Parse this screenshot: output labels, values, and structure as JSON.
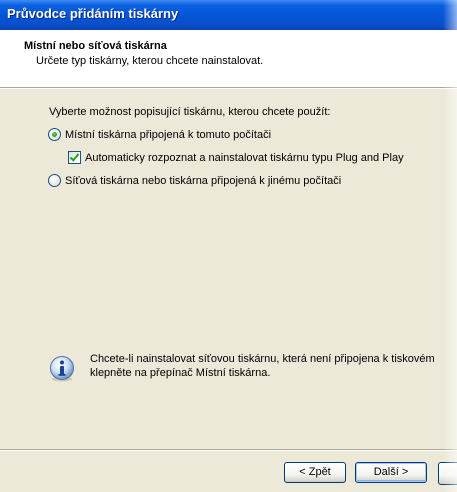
{
  "window": {
    "title": "Průvodce přidáním tiskárny"
  },
  "header": {
    "title": "Místní nebo síťová tiskárna",
    "subtitle": "Určete typ tiskárny, kterou chcete nainstalovat."
  },
  "content": {
    "prompt": "Vyberte možnost popisující tiskárnu, kterou chcete použít:",
    "options": [
      {
        "label": "Místní tiskárna připojená k tomuto počítači",
        "checked": true
      },
      {
        "label": "Síťová tiskárna nebo tiskárna připojená k jinému počítači",
        "checked": false
      }
    ],
    "plug_and_play": {
      "label": "Automaticky rozpoznat a nainstalovat tiskárnu typu Plug and Play",
      "checked": true
    },
    "info": {
      "line1": "Chcete-li nainstalovat síťovou tiskárnu, která není připojena k tiskovém",
      "line2": "klepněte na přepínač Místní tiskárna."
    }
  },
  "buttons": {
    "back": "< Zpět",
    "next": "Další >"
  },
  "colors": {
    "titlebar": "#0454d6",
    "dialog_bg": "#ece9d8",
    "radio_dot": "#21a121"
  }
}
